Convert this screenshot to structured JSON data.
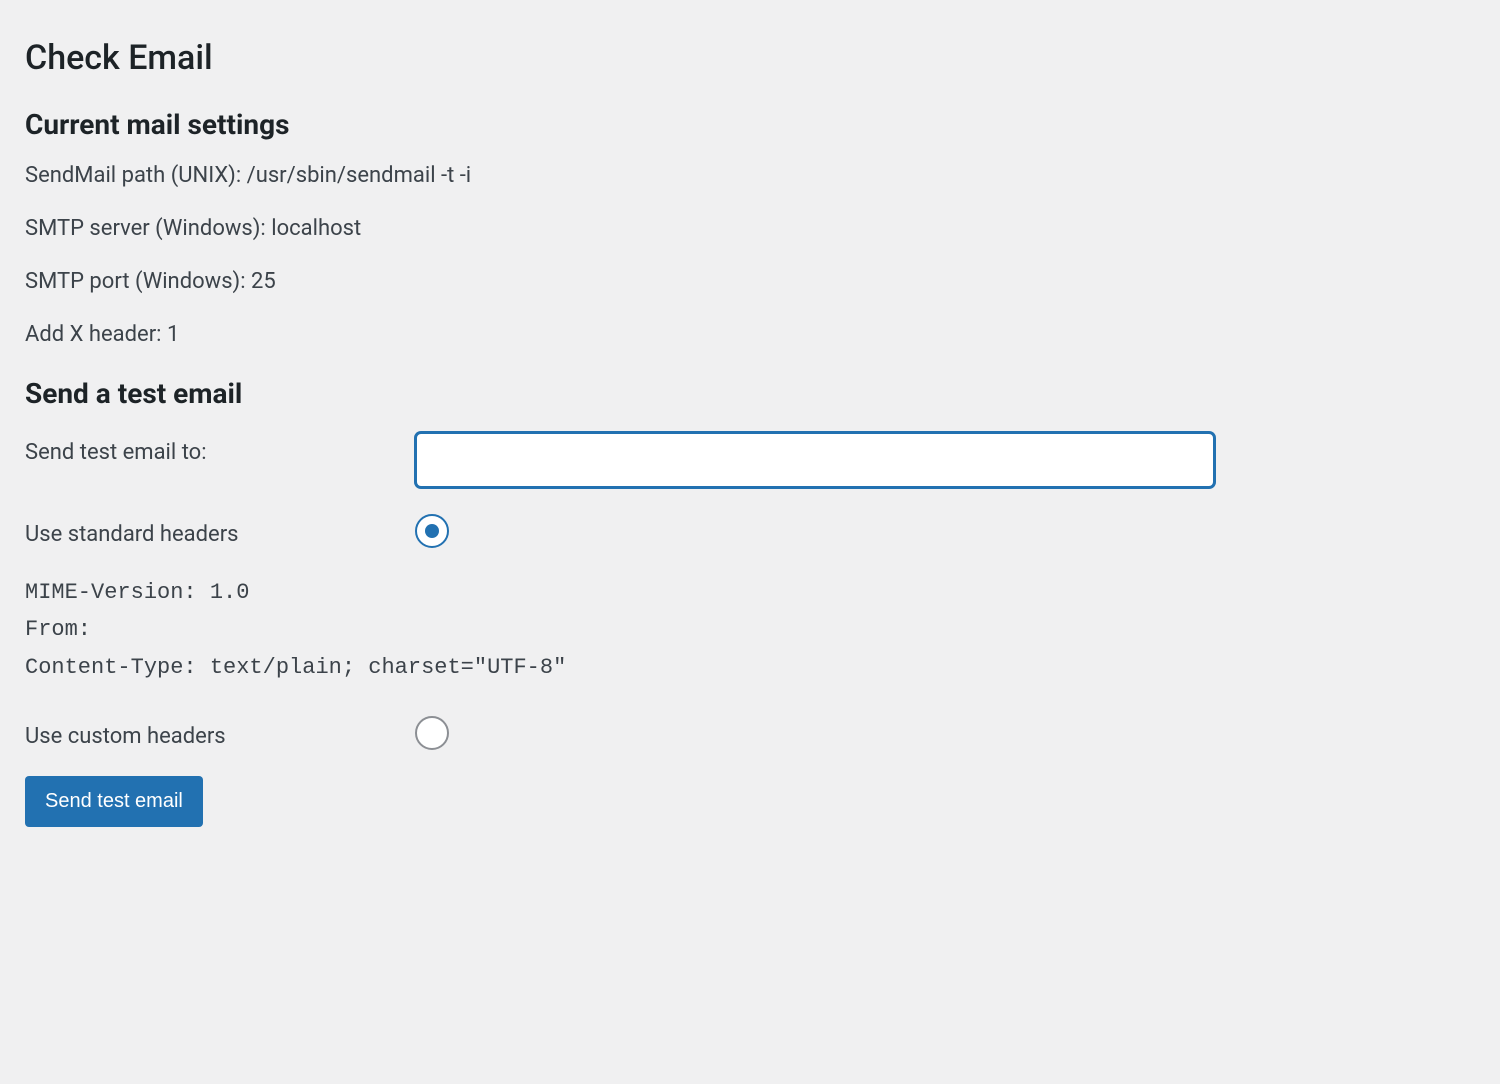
{
  "page": {
    "title": "Check Email"
  },
  "settings": {
    "heading": "Current mail settings",
    "sendmail_label": "SendMail path (UNIX):",
    "sendmail_value": "/usr/sbin/sendmail -t -i",
    "smtp_server_label": "SMTP server (Windows):",
    "smtp_server_value": "localhost",
    "smtp_port_label": "SMTP port (Windows):",
    "smtp_port_value": "25",
    "xheader_label": "Add X header:",
    "xheader_value": "1"
  },
  "test": {
    "heading": "Send a test email",
    "to_label": "Send test email to:",
    "to_value": "",
    "standard_label": "Use standard headers",
    "headers_block": "MIME-Version: 1.0\nFrom:\nContent-Type: text/plain; charset=\"UTF-8\"",
    "custom_label": "Use custom headers",
    "submit_label": "Send test email"
  }
}
